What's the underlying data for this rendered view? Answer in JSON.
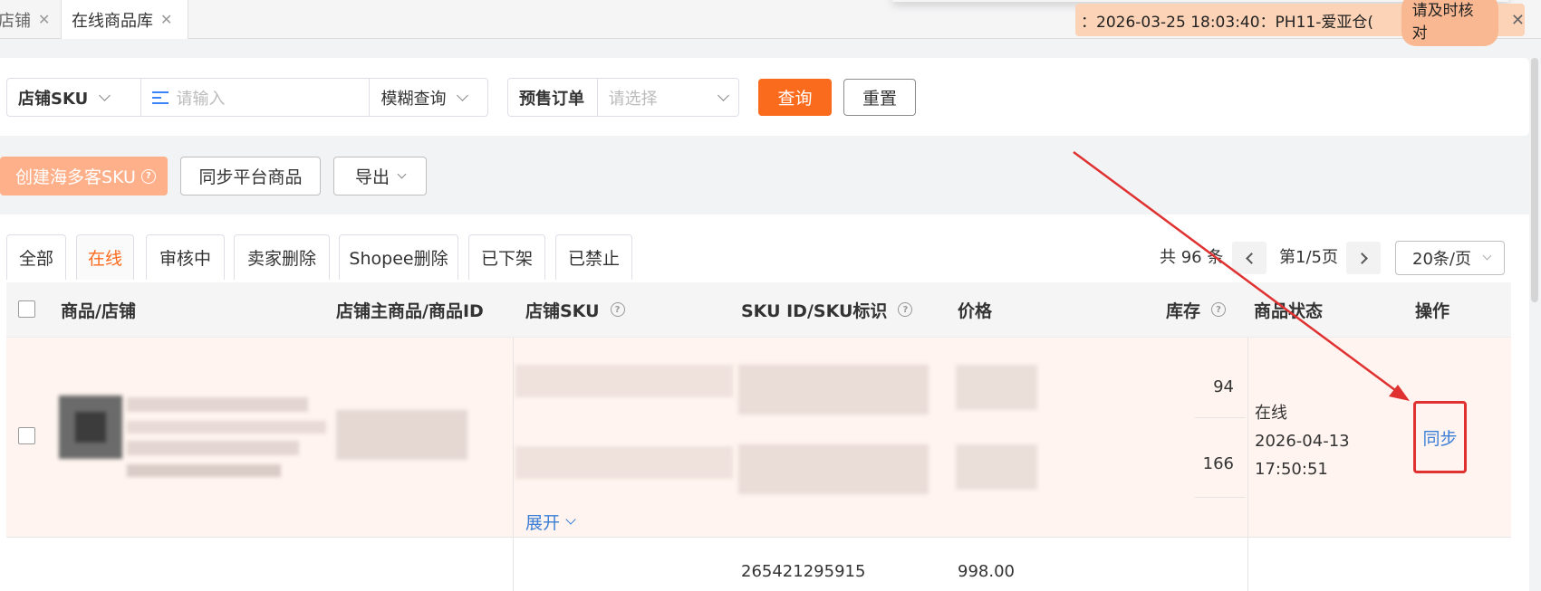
{
  "tabs": [
    {
      "label": "店铺",
      "close": "✕"
    },
    {
      "label": "在线商品库",
      "close": "✕"
    }
  ],
  "notice": {
    "text": "：2026-03-25 18:03:40：PH11-爱亚仓(",
    "action": "请及时核对",
    "close": "✕"
  },
  "filters": {
    "field_select": "店铺SKU",
    "input_placeholder": "请输入",
    "match_mode": "模糊查询",
    "presale_label": "预售订单",
    "presale_placeholder": "请选择",
    "search_button": "查询",
    "reset_button": "重置"
  },
  "actions": {
    "create_sku": "创建海多客SKU",
    "sync_platform": "同步平台商品",
    "export": "导出"
  },
  "status_tabs": [
    "全部",
    "在线",
    "审核中",
    "卖家删除",
    "Shopee删除",
    "已下架",
    "已禁止"
  ],
  "active_status_tab": "在线",
  "pagination": {
    "total": "共 96 条",
    "page": "第1/5页",
    "page_size": "20条/页"
  },
  "table": {
    "columns": {
      "product": "商品/店铺",
      "main_id": "店铺主商品/商品ID",
      "store_sku": "店铺SKU",
      "sku_id": "SKU ID/SKU标识",
      "price": "价格",
      "stock": "库存",
      "status": "商品状态",
      "ops": "操作"
    },
    "row1": {
      "stocks": [
        "94",
        "166"
      ],
      "status": "在线",
      "date": "2026-04-13",
      "time": "17:50:51",
      "action": "同步",
      "expand": "展开"
    },
    "row2": {
      "sku_id": "265421295915",
      "price": "998.00"
    }
  },
  "colors": {
    "accent": "#fb6b1e",
    "link": "#3b7ed6",
    "annotation": "#e03131",
    "row_highlight": "#fff4ef"
  }
}
